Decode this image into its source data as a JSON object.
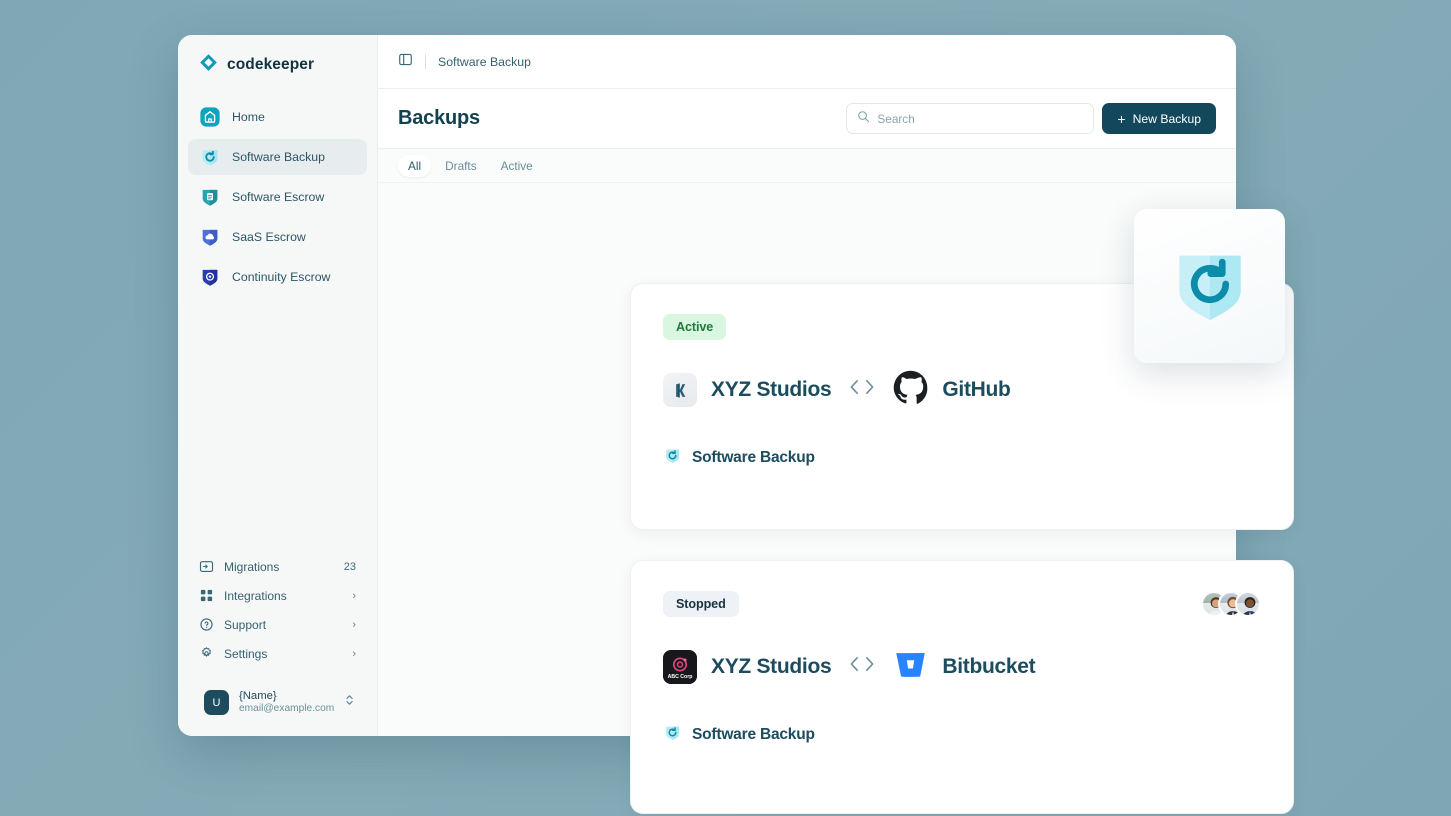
{
  "theme": {
    "page_background": "#7fa7b5",
    "brand_teal": "#0e9ab8",
    "dark_teal": "#13485c",
    "accent_text": "#1c4c5e",
    "active_chip_bg": "#d9f7e0",
    "active_chip_text": "#1d7a3e",
    "stopped_chip_bg": "#eef1f5",
    "stopped_chip_text": "#19323f"
  },
  "sidebar": {
    "brand": {
      "name": "codekeeper",
      "logo_icon": "diamond-logo-icon"
    },
    "items": [
      {
        "label": "Home",
        "icon": "home-shield-icon",
        "active": false
      },
      {
        "label": "Software Backup",
        "icon": "backup-shield-icon",
        "active": true
      },
      {
        "label": "Software Escrow",
        "icon": "document-shield-icon",
        "active": false
      },
      {
        "label": "SaaS Escrow",
        "icon": "cloud-shield-icon",
        "active": false
      },
      {
        "label": "Continuity Escrow",
        "icon": "target-shield-icon",
        "active": false
      }
    ],
    "secondary_items": [
      {
        "label": "Migrations",
        "icon": "migrations-icon",
        "badge": "23",
        "chevron": false
      },
      {
        "label": "Integrations",
        "icon": "grid-icon",
        "badge": "",
        "chevron": true
      },
      {
        "label": "Support",
        "icon": "help-circle-icon",
        "badge": "",
        "chevron": true
      },
      {
        "label": "Settings",
        "icon": "gear-icon",
        "badge": "",
        "chevron": true
      }
    ],
    "chevron_glyph": "›",
    "user": {
      "initial": "U",
      "name": "{Name}",
      "email": "email@example.com",
      "switcher_icon": "chevron-up-down-icon"
    }
  },
  "topbar": {
    "toggle_icon": "sidebar-toggle-icon",
    "breadcrumb": "Software Backup"
  },
  "pagehead": {
    "title": "Backups",
    "search": {
      "placeholder": "Search",
      "value": "",
      "icon": "search-icon"
    },
    "new_backup_label": "New Backup",
    "new_backup_icon": "plus-icon"
  },
  "tabs": [
    {
      "label": "All",
      "active": true
    },
    {
      "label": "Drafts",
      "active": false
    },
    {
      "label": "Active",
      "active": false
    }
  ],
  "cards": [
    {
      "status": "Active",
      "status_style": "active",
      "org_name": "XYZ Studios",
      "org_logo_icon": "xyz-studios-logo-icon",
      "org_logo_style": "light",
      "connector_icon": "code-brackets-icon",
      "provider": "GitHub",
      "provider_icon": "github-icon",
      "service_label": "Software Backup",
      "service_icon": "backup-shield-icon",
      "avatar_count": 2
    },
    {
      "status": "Stopped",
      "status_style": "stopped",
      "org_name": "XYZ Studios",
      "org_logo_icon": "abc-corp-logo-icon",
      "org_logo_style": "dark",
      "org_logo_text": "ABC Corp",
      "connector_icon": "code-brackets-icon",
      "provider": "Bitbucket",
      "provider_icon": "bitbucket-icon",
      "service_label": "Software Backup",
      "service_icon": "backup-shield-icon",
      "avatar_count": 3
    }
  ],
  "floating_tile": {
    "icon": "backup-shield-refresh-icon"
  }
}
